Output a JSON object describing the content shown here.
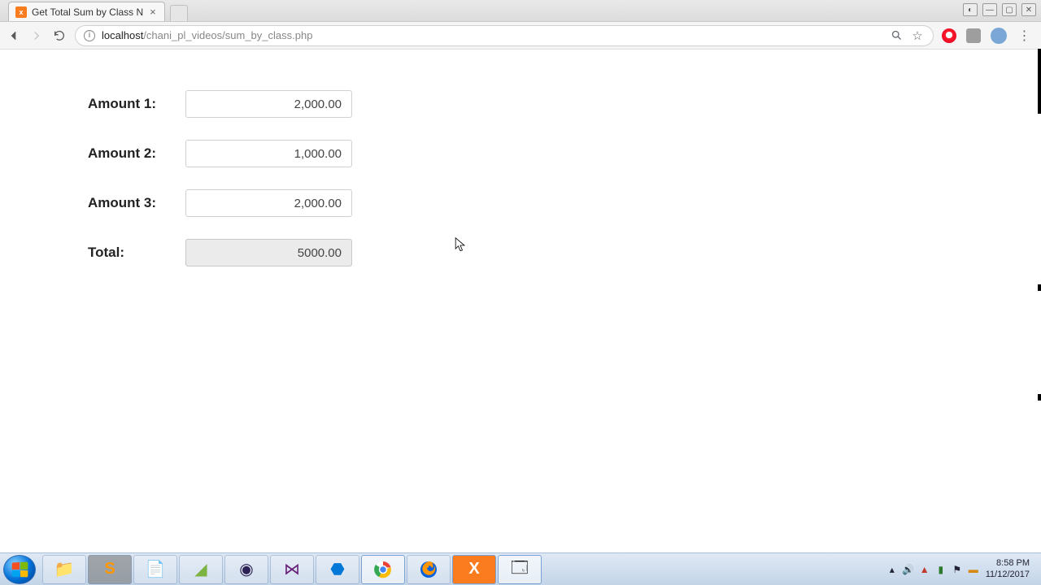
{
  "browser": {
    "tab_title": "Get Total Sum by Class N",
    "url_host": "localhost",
    "url_path": "/chani_pl_videos/sum_by_class.php"
  },
  "form": {
    "rows": [
      {
        "label": "Amount 1:",
        "value": "2,000.00"
      },
      {
        "label": "Amount 2:",
        "value": "1,000.00"
      },
      {
        "label": "Amount 3:",
        "value": "2,000.00"
      }
    ],
    "total_label": "Total:",
    "total_value": "5000.00"
  },
  "taskbar": {
    "time": "8:58 PM",
    "date": "11/12/2017"
  }
}
